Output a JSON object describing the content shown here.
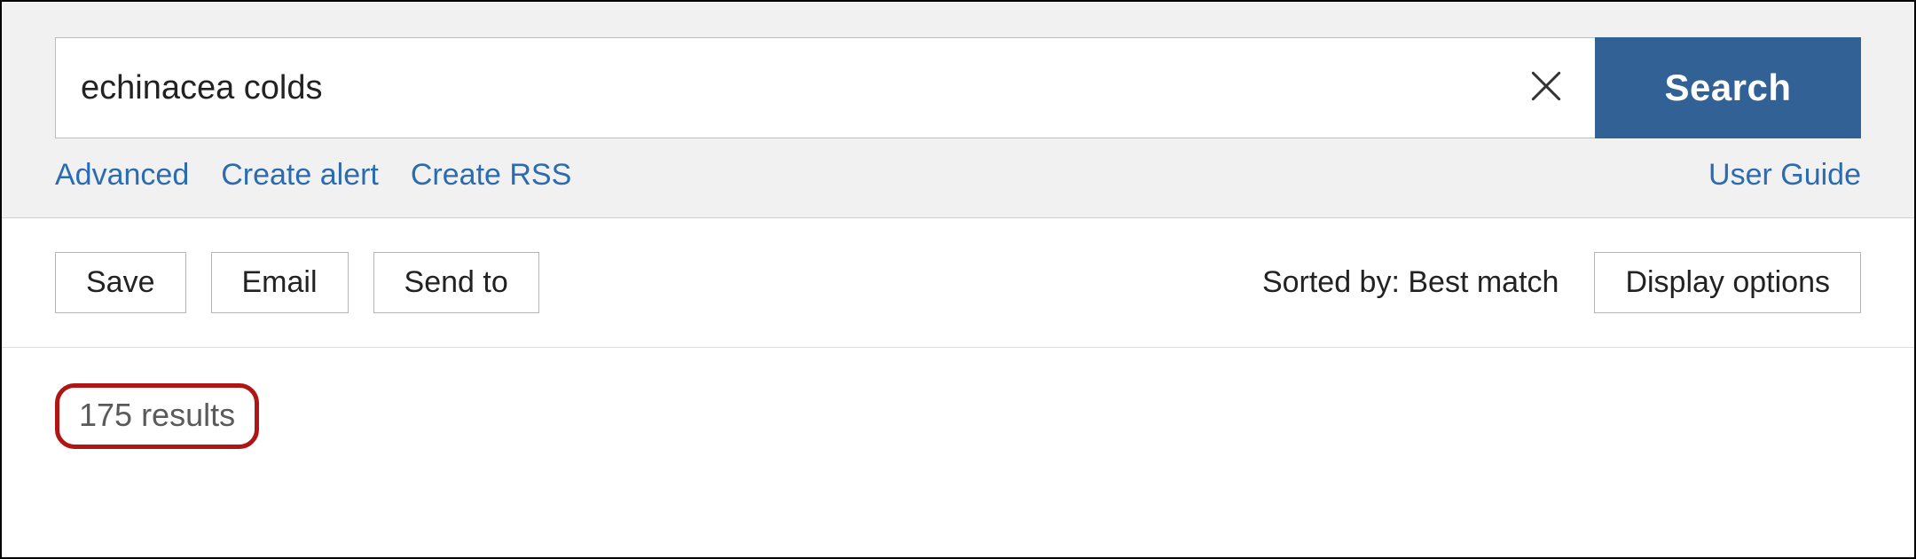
{
  "search": {
    "query": "echinacea colds",
    "placeholder": "Search",
    "button_label": "Search"
  },
  "links": {
    "advanced": "Advanced",
    "create_alert": "Create alert",
    "create_rss": "Create RSS",
    "user_guide": "User Guide"
  },
  "toolbar": {
    "save": "Save",
    "email": "Email",
    "send_to": "Send to",
    "sorted_by_label": "Sorted by: ",
    "sorted_by_value": "Best match",
    "display_options": "Display options"
  },
  "results": {
    "count_text": "175 results"
  },
  "colors": {
    "brand_blue": "#326295",
    "link_blue": "#2b6cb0",
    "highlight_red": "#b01515"
  }
}
